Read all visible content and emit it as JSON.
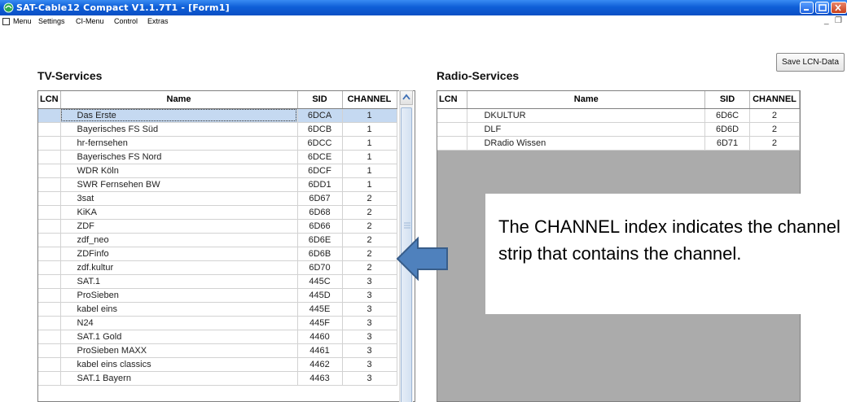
{
  "window": {
    "title": "SAT-Cable12 Compact V1.1.7T1 - [Form1]"
  },
  "menubar": {
    "items": [
      "Menu",
      "Settings",
      "CI-Menu",
      "Control",
      "Extras"
    ]
  },
  "save_button": "Save LCN-Data",
  "tv": {
    "title": "TV-Services",
    "columns": [
      "LCN",
      "Name",
      "SID",
      "CHANNEL"
    ],
    "rows": [
      {
        "lcn": "",
        "name": "Das Erste",
        "sid": "6DCA",
        "channel": "1"
      },
      {
        "lcn": "",
        "name": "Bayerisches FS Süd",
        "sid": "6DCB",
        "channel": "1"
      },
      {
        "lcn": "",
        "name": "hr-fernsehen",
        "sid": "6DCC",
        "channel": "1"
      },
      {
        "lcn": "",
        "name": "Bayerisches FS Nord",
        "sid": "6DCE",
        "channel": "1"
      },
      {
        "lcn": "",
        "name": "WDR Köln",
        "sid": "6DCF",
        "channel": "1"
      },
      {
        "lcn": "",
        "name": "SWR Fernsehen BW",
        "sid": "6DD1",
        "channel": "1"
      },
      {
        "lcn": "",
        "name": "3sat",
        "sid": "6D67",
        "channel": "2"
      },
      {
        "lcn": "",
        "name": "KiKA",
        "sid": "6D68",
        "channel": "2"
      },
      {
        "lcn": "",
        "name": "ZDF",
        "sid": "6D66",
        "channel": "2"
      },
      {
        "lcn": "",
        "name": "zdf_neo",
        "sid": "6D6E",
        "channel": "2"
      },
      {
        "lcn": "",
        "name": "ZDFinfo",
        "sid": "6D6B",
        "channel": "2"
      },
      {
        "lcn": "",
        "name": "zdf.kultur",
        "sid": "6D70",
        "channel": "2"
      },
      {
        "lcn": "",
        "name": "SAT.1",
        "sid": "445C",
        "channel": "3"
      },
      {
        "lcn": "",
        "name": "ProSieben",
        "sid": "445D",
        "channel": "3"
      },
      {
        "lcn": "",
        "name": "kabel eins",
        "sid": "445E",
        "channel": "3"
      },
      {
        "lcn": "",
        "name": "N24",
        "sid": "445F",
        "channel": "3"
      },
      {
        "lcn": "",
        "name": "SAT.1 Gold",
        "sid": "4460",
        "channel": "3"
      },
      {
        "lcn": "",
        "name": "ProSieben MAXX",
        "sid": "4461",
        "channel": "3"
      },
      {
        "lcn": "",
        "name": "kabel eins classics",
        "sid": "4462",
        "channel": "3"
      },
      {
        "lcn": "",
        "name": "SAT.1 Bayern",
        "sid": "4463",
        "channel": "3"
      }
    ]
  },
  "radio": {
    "title": "Radio-Services",
    "columns": [
      "LCN",
      "Name",
      "SID",
      "CHANNEL"
    ],
    "rows": [
      {
        "lcn": "",
        "name": "DKULTUR",
        "sid": "6D6C",
        "channel": "2"
      },
      {
        "lcn": "",
        "name": "DLF",
        "sid": "6D6D",
        "channel": "2"
      },
      {
        "lcn": "",
        "name": "DRadio Wissen",
        "sid": "6D71",
        "channel": "2"
      }
    ]
  },
  "callout": {
    "text": "The CHANNEL index indicates the channel strip that contains the channel."
  },
  "colors": {
    "titlebar": "#0f5fd8",
    "selection": "#c5d9f1",
    "arrow_fill": "#4f81bd",
    "arrow_stroke": "#385d8a",
    "empty_area": "#ababab"
  }
}
